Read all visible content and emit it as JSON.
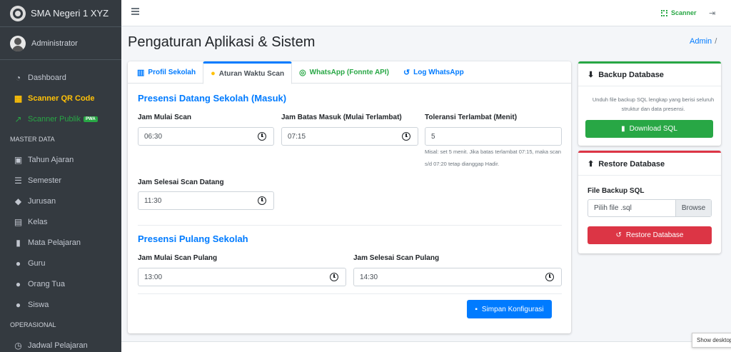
{
  "brand": {
    "name": "SMA Negeri 1 XYZ"
  },
  "user": {
    "name": "Administrator"
  },
  "sidebar": {
    "items": [
      {
        "label": "Dashboard",
        "icon": "tachometer-icon"
      },
      {
        "label": "Scanner QR Code",
        "icon": "qrcode-icon"
      },
      {
        "label": "Scanner Publik",
        "icon": "external-link-icon",
        "badge": "PWA"
      },
      {
        "header": "MASTER DATA"
      },
      {
        "label": "Tahun Ajaran",
        "icon": "calendar-icon"
      },
      {
        "label": "Semester",
        "icon": "list-icon"
      },
      {
        "label": "Jurusan",
        "icon": "graduation-cap-icon"
      },
      {
        "label": "Kelas",
        "icon": "chalkboard-icon"
      },
      {
        "label": "Mata Pelajaran",
        "icon": "book-icon"
      },
      {
        "label": "Guru",
        "icon": "user-tie-icon"
      },
      {
        "label": "Orang Tua",
        "icon": "users-icon"
      },
      {
        "label": "Siswa",
        "icon": "user-graduate-icon"
      },
      {
        "header": "OPERASIONAL"
      },
      {
        "label": "Jadwal Pelajaran",
        "icon": "clock-icon"
      }
    ]
  },
  "topbar": {
    "scanner_label": "Scanner"
  },
  "page": {
    "title": "Pengaturan Aplikasi & Sistem",
    "breadcrumb_admin": "Admin",
    "breadcrumb_sep": "/"
  },
  "tabs": [
    {
      "label": "Profil Sekolah"
    },
    {
      "label": "Aturan Waktu Scan"
    },
    {
      "label": "WhatsApp (Fonnte API)"
    },
    {
      "label": "Log WhatsApp"
    }
  ],
  "masuk": {
    "title": "Presensi Datang Sekolah (Masuk)",
    "jam_mulai_label": "Jam Mulai Scan",
    "jam_mulai_value": "06:30",
    "jam_batas_label": "Jam Batas Masuk (Mulai Terlambat)",
    "jam_batas_value": "07:15",
    "toleransi_label": "Toleransi Terlambat (Menit)",
    "toleransi_value": "5",
    "toleransi_hint": "Misal: set 5 menit. Jika batas terlambat 07:15, maka scan s/d 07:20 tetap dianggap Hadir.",
    "jam_selesai_label": "Jam Selesai Scan Datang",
    "jam_selesai_value": "11:30"
  },
  "pulang": {
    "title": "Presensi Pulang Sekolah",
    "jam_mulai_label": "Jam Mulai Scan Pulang",
    "jam_mulai_value": "13:00",
    "jam_selesai_label": "Jam Selesai Scan Pulang",
    "jam_selesai_value": "14:30"
  },
  "save_button": "Simpan Konfigurasi",
  "backup": {
    "title": "Backup Database",
    "description": "Unduh file backup SQL lengkap yang berisi seluruh struktur dan data presensi.",
    "button": "Download SQL"
  },
  "restore": {
    "title": "Restore Database",
    "file_label": "File Backup SQL",
    "file_placeholder": "Pilih file .sql",
    "browse": "Browse",
    "button": "Restore Database"
  },
  "overlay": {
    "show_desktop": "Show desktop"
  },
  "colors": {
    "primary": "#007bff",
    "success": "#28a745",
    "danger": "#dc3545",
    "warning": "#ffc107",
    "sidebar_bg": "#343a40"
  }
}
